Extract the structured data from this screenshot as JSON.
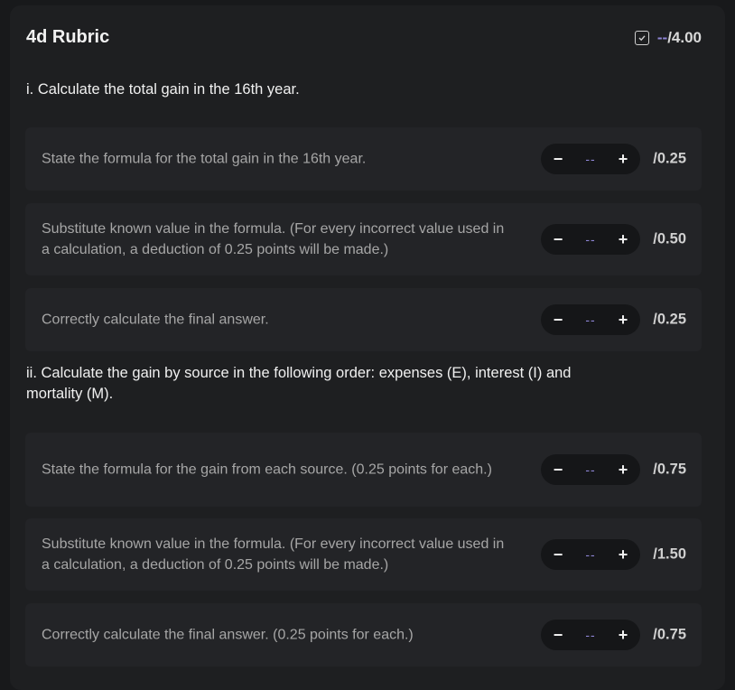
{
  "rubric": {
    "title": "4d Rubric",
    "total_score": "--",
    "total_max": "/4.00"
  },
  "sections": [
    {
      "title": "i. Calculate the total gain in the 16th year.",
      "items": [
        {
          "text": "State the formula for the total gain in the 16th year.",
          "value": "--",
          "max": "/0.25"
        },
        {
          "text": "Substitute known value in the formula. (For every incorrect value used in a calculation, a deduction of 0.25 points will be made.)",
          "value": "--",
          "max": "/0.50"
        },
        {
          "text": "Correctly calculate the final answer.",
          "value": "--",
          "max": "/0.25"
        }
      ]
    },
    {
      "title": "ii. Calculate the gain by source in the following order: expenses (E), interest (I) and mortality (M).",
      "items": [
        {
          "text": "State the formula for the gain from each source. (0.25 points for each.)",
          "value": "--",
          "max": "/0.75"
        },
        {
          "text": "Substitute known value in the formula. (For every incorrect value used in a calculation, a deduction of 0.25 points will be made.)",
          "value": "--",
          "max": "/1.50"
        },
        {
          "text": "Correctly calculate the final answer. (0.25 points for each.)",
          "value": "--",
          "max": "/0.75"
        }
      ]
    }
  ],
  "stepper": {
    "minus": "−",
    "plus": "+"
  },
  "icons": {
    "score": "checkbox-icon"
  },
  "colors": {
    "accent": "#8f86d6",
    "background": "#18191b",
    "card": "#1e1f21",
    "item": "#232427"
  }
}
